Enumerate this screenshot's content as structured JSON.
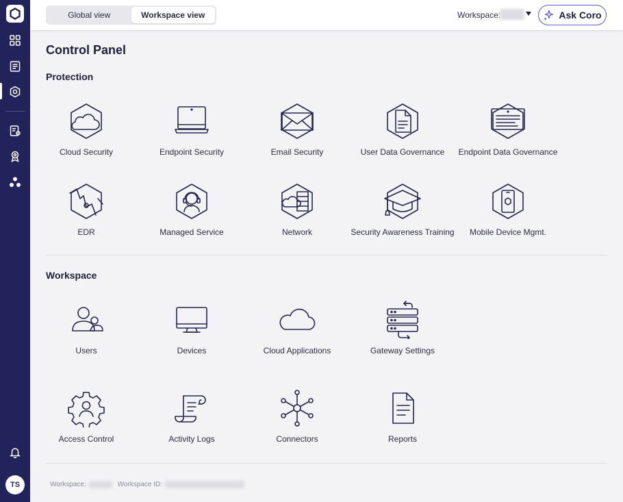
{
  "top_bar": {
    "views": [
      {
        "label": "Global view",
        "active": false
      },
      {
        "label": "Workspace view",
        "active": true
      }
    ],
    "workspace_label": "Workspace:",
    "ask_button": "Ask Coro"
  },
  "page": {
    "title": "Control Panel"
  },
  "sections": {
    "protection": {
      "title": "Protection",
      "items": [
        {
          "label": "Cloud Security",
          "icon": "cloud-security-icon"
        },
        {
          "label": "Endpoint Security",
          "icon": "endpoint-security-icon"
        },
        {
          "label": "Email Security",
          "icon": "email-security-icon"
        },
        {
          "label": "User Data Governance",
          "icon": "user-data-governance-icon"
        },
        {
          "label": "Endpoint Data Governance",
          "icon": "endpoint-data-governance-icon"
        },
        {
          "label": "EDR",
          "icon": "edr-icon"
        },
        {
          "label": "Managed Service",
          "icon": "managed-service-icon"
        },
        {
          "label": "Network",
          "icon": "network-icon"
        },
        {
          "label": "Security Awareness Training",
          "icon": "graduation-cap-icon"
        },
        {
          "label": "Mobile Device Mgmt.",
          "icon": "mobile-device-icon"
        }
      ]
    },
    "workspace": {
      "title": "Workspace",
      "items": [
        {
          "label": "Users",
          "icon": "users-icon"
        },
        {
          "label": "Devices",
          "icon": "laptop-icon"
        },
        {
          "label": "Cloud Applications",
          "icon": "cloud-icon"
        },
        {
          "label": "Gateway Settings",
          "icon": "gateway-icon"
        },
        {
          "label": "Access Control",
          "icon": "access-control-icon"
        },
        {
          "label": "Activity Logs",
          "icon": "scroll-icon"
        },
        {
          "label": "Connectors",
          "icon": "connectors-icon"
        },
        {
          "label": "Reports",
          "icon": "report-icon"
        }
      ]
    }
  },
  "footer": {
    "workspace_label": "Workspace:",
    "workspace_id_label": "Workspace ID:"
  },
  "user": {
    "initials": "TS"
  },
  "colors": {
    "sidebar": "#23235b",
    "accent": "#5b5bd6",
    "icon_stroke": "#25254e",
    "background": "#f3f3f6"
  }
}
